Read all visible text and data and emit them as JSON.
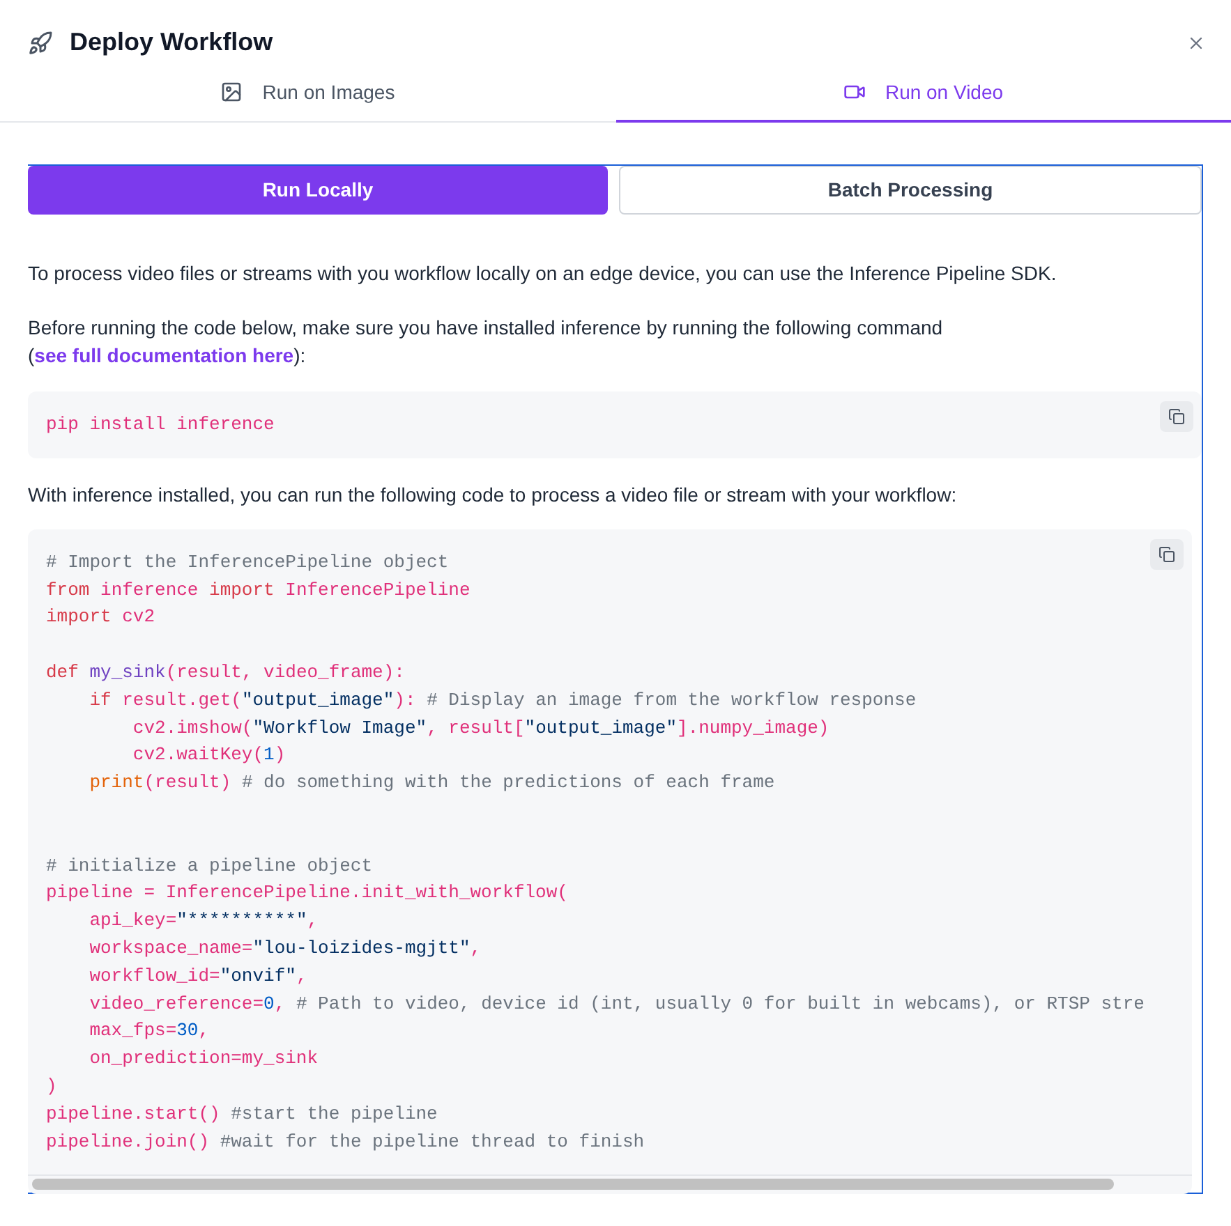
{
  "dialog": {
    "title": "Deploy Workflow"
  },
  "tabs": [
    {
      "label": "Run on Images",
      "selected": false
    },
    {
      "label": "Run on Video",
      "selected": true
    }
  ],
  "mode_buttons": [
    {
      "label": "Run Locally",
      "selected": true
    },
    {
      "label": "Batch Processing",
      "selected": false
    }
  ],
  "intro": "To process video files or streams with you workflow locally on an edge device, you can use the Inference Pipeline SDK.",
  "install_note": {
    "text": "Before running the code below, make sure you have installed inference by running the following command (",
    "link": "see full documentation here",
    "after": "):"
  },
  "install_code": [
    {
      "kind": "code",
      "segments": [
        {
          "kind": "name",
          "t": "pip install inference"
        }
      ]
    }
  ],
  "usage_note": "With inference installed, you can run the following code to process a video file or stream with your workflow:",
  "code": [
    {
      "kind": "code",
      "segments": [
        {
          "kind": "comment",
          "t": "# Import the InferencePipeline object"
        }
      ]
    },
    {
      "kind": "code",
      "segments": [
        {
          "kind": "keyword",
          "t": "from "
        },
        {
          "kind": "name",
          "t": "inference "
        },
        {
          "kind": "keyword",
          "t": "import "
        },
        {
          "kind": "name",
          "t": "InferencePipeline"
        }
      ]
    },
    {
      "kind": "code",
      "segments": [
        {
          "kind": "keyword",
          "t": "import "
        },
        {
          "kind": "name",
          "t": "cv2"
        }
      ]
    },
    {
      "kind": "blank"
    },
    {
      "kind": "code",
      "segments": [
        {
          "kind": "keyword",
          "t": "def "
        },
        {
          "kind": "function",
          "t": "my_sink"
        },
        {
          "kind": "name",
          "t": "(result, video_frame):"
        }
      ]
    },
    {
      "kind": "code",
      "segments": [
        {
          "kind": "keyword",
          "t": "    if "
        },
        {
          "kind": "name",
          "t": "result.get("
        },
        {
          "kind": "string",
          "t": "\"output_image\""
        },
        {
          "kind": "name",
          "t": "): "
        },
        {
          "kind": "comment",
          "t": "# Display an image from the workflow response"
        }
      ]
    },
    {
      "kind": "code",
      "segments": [
        {
          "kind": "name",
          "t": "        cv2.imshow("
        },
        {
          "kind": "string",
          "t": "\"Workflow Image\""
        },
        {
          "kind": "name",
          "t": ", result["
        },
        {
          "kind": "string",
          "t": "\"output_image\""
        },
        {
          "kind": "name",
          "t": "].numpy_image)"
        }
      ]
    },
    {
      "kind": "code",
      "segments": [
        {
          "kind": "name",
          "t": "        cv2.waitKey("
        },
        {
          "kind": "number",
          "t": "1"
        },
        {
          "kind": "name",
          "t": ")"
        }
      ]
    },
    {
      "kind": "code",
      "segments": [
        {
          "kind": "builtin",
          "t": "    print"
        },
        {
          "kind": "name",
          "t": "(result) "
        },
        {
          "kind": "comment",
          "t": "# do something with the predictions of each frame"
        }
      ]
    },
    {
      "kind": "blank"
    },
    {
      "kind": "blank"
    },
    {
      "kind": "code",
      "segments": [
        {
          "kind": "comment",
          "t": "# initialize a pipeline object"
        }
      ]
    },
    {
      "kind": "code",
      "segments": [
        {
          "kind": "name",
          "t": "pipeline = InferencePipeline.init_with_workflow("
        }
      ]
    },
    {
      "kind": "code",
      "segments": [
        {
          "kind": "name",
          "t": "    api_key="
        },
        {
          "kind": "string",
          "t": "\"**********\""
        },
        {
          "kind": "name",
          "t": ","
        }
      ]
    },
    {
      "kind": "code",
      "segments": [
        {
          "kind": "name",
          "t": "    workspace_name="
        },
        {
          "kind": "string",
          "t": "\"lou-loizides-mgjtt\""
        },
        {
          "kind": "name",
          "t": ","
        }
      ]
    },
    {
      "kind": "code",
      "segments": [
        {
          "kind": "name",
          "t": "    workflow_id="
        },
        {
          "kind": "string",
          "t": "\"onvif\""
        },
        {
          "kind": "name",
          "t": ","
        }
      ]
    },
    {
      "kind": "code",
      "segments": [
        {
          "kind": "name",
          "t": "    video_reference="
        },
        {
          "kind": "number",
          "t": "0"
        },
        {
          "kind": "name",
          "t": ", "
        },
        {
          "kind": "comment",
          "t": "# Path to video, device id (int, usually 0 for built in webcams), or RTSP stre"
        }
      ]
    },
    {
      "kind": "code",
      "segments": [
        {
          "kind": "name",
          "t": "    max_fps="
        },
        {
          "kind": "number",
          "t": "30"
        },
        {
          "kind": "name",
          "t": ","
        }
      ]
    },
    {
      "kind": "code",
      "segments": [
        {
          "kind": "name",
          "t": "    on_prediction=my_sink"
        }
      ]
    },
    {
      "kind": "code",
      "segments": [
        {
          "kind": "name",
          "t": ")"
        }
      ]
    },
    {
      "kind": "code",
      "segments": [
        {
          "kind": "name",
          "t": "pipeline.start() "
        },
        {
          "kind": "comment",
          "t": "#start the pipeline"
        }
      ]
    },
    {
      "kind": "code",
      "segments": [
        {
          "kind": "name",
          "t": "pipeline.join() "
        },
        {
          "kind": "comment",
          "t": "#wait for the pipeline thread to finish"
        }
      ]
    }
  ]
}
